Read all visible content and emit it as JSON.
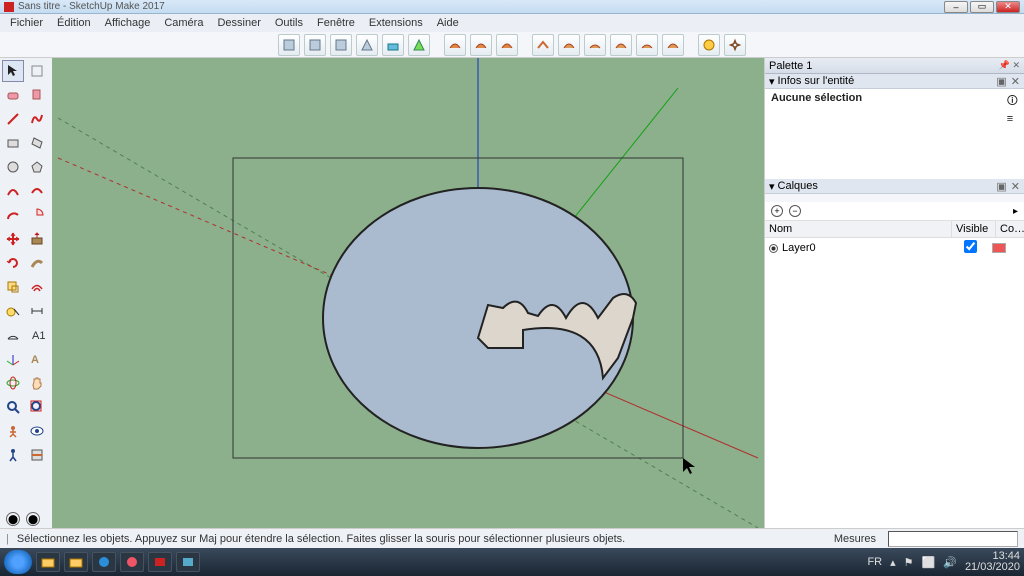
{
  "window": {
    "title": "Sans titre - SketchUp Make 2017"
  },
  "menu": {
    "items": [
      "Fichier",
      "Édition",
      "Affichage",
      "Caméra",
      "Dessiner",
      "Outils",
      "Fenêtre",
      "Extensions",
      "Aide"
    ]
  },
  "side": {
    "palette_title": "Palette 1",
    "entity_title": "Infos sur l'entité",
    "entity_body": "Aucune sélection",
    "layers_title": "Calques",
    "layers_headers": {
      "name": "Nom",
      "visible": "Visible",
      "color": "Co…"
    },
    "layers": [
      {
        "name": "Layer0",
        "visible": true
      }
    ]
  },
  "status": {
    "hint": "Sélectionnez les objets. Appuyez sur Maj pour étendre la sélection. Faites glisser la souris pour sélectionner plusieurs objets.",
    "measure_label": "Mesures"
  },
  "taskbar": {
    "lang": "FR",
    "time": "13:44",
    "date": "21/03/2020"
  }
}
